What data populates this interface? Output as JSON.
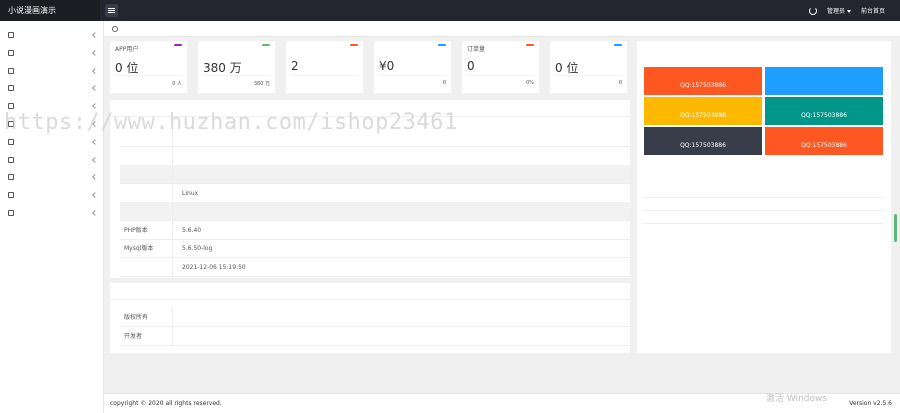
{
  "topbar": {
    "brand": "小说漫画演示",
    "user": "管理员",
    "home": "前台首页"
  },
  "sidebar": {
    "items": [
      {
        "label": "",
        "icon": "gear-icon"
      },
      {
        "label": "",
        "icon": "book-icon"
      },
      {
        "label": "",
        "icon": "file-icon"
      },
      {
        "label": "",
        "icon": "box-icon"
      },
      {
        "label": "",
        "icon": "audio-icon"
      },
      {
        "label": "",
        "icon": "user-icon"
      },
      {
        "label": "",
        "icon": "gift-icon"
      },
      {
        "label": "",
        "icon": "money-icon"
      },
      {
        "label": "",
        "icon": "ad-icon"
      },
      {
        "label": "",
        "icon": "app-icon"
      },
      {
        "label": "",
        "icon": "admin-icon"
      }
    ]
  },
  "breadcrumb": {
    "text": ""
  },
  "stats": [
    {
      "title": "APP用户",
      "tag": "",
      "tag_color": "#9c27b0",
      "value": "0 位",
      "foot_l": "",
      "foot_r": "0 人"
    },
    {
      "title": "",
      "tag": "",
      "tag_color": "#5fb878",
      "value": "380 万",
      "foot_l": "",
      "foot_r": "380 万"
    },
    {
      "title": "",
      "tag": "",
      "tag_color": "#ff5722",
      "value": "2",
      "foot_l": "",
      "foot_r": ""
    },
    {
      "title": "",
      "tag": "",
      "tag_color": "#1e9fff",
      "value": "¥0",
      "foot_l": "",
      "foot_r": "0"
    },
    {
      "title": "订单量",
      "tag": "",
      "tag_color": "#ff5722",
      "value": "0",
      "foot_l": "",
      "foot_r": "0%"
    },
    {
      "title": "",
      "tag": "",
      "tag_color": "#1e9fff",
      "value": "0 位",
      "foot_l": "",
      "foot_r": "0"
    }
  ],
  "system": {
    "title": "",
    "rows": [
      {
        "k": "",
        "v": ""
      },
      {
        "k": "",
        "v": ""
      },
      {
        "k": "",
        "v": ""
      },
      {
        "k": "",
        "v": "Linux"
      },
      {
        "k": "",
        "v": ""
      },
      {
        "k": "PHP版本",
        "v": "5.6.40"
      },
      {
        "k": "Mysql版本",
        "v": "5.6.50-log"
      },
      {
        "k": "",
        "v": "2021-12-06 15:19:50"
      }
    ]
  },
  "team": {
    "title": "",
    "rows": [
      {
        "k": "版权所有",
        "v": ""
      },
      {
        "k": "开发者",
        "v": ""
      }
    ]
  },
  "ads": {
    "title": "",
    "items": [
      {
        "l1": "",
        "l2": "QQ:157503886",
        "color": "#ff5722"
      },
      {
        "l1": "",
        "l2": "",
        "color": "#1e9fff"
      },
      {
        "l1": "",
        "l2": "QQ:157503886",
        "color": "#ffb800"
      },
      {
        "l1": "",
        "l2": "QQ:157503886",
        "color": "#009688"
      },
      {
        "l1": "",
        "l2": "QQ:157503886",
        "color": "#393d49"
      },
      {
        "l1": "",
        "l2": "QQ:157503886",
        "color": "#ff5722"
      }
    ]
  },
  "notices": {
    "title": "",
    "items": [
      {
        "text": "",
        "date": ""
      },
      {
        "text": "",
        "date": ""
      },
      {
        "text": "",
        "date": ""
      }
    ]
  },
  "footer": {
    "copy_prefix": "copyright © 2020",
    "copy_link": "",
    "copy_suffix": "all rights reserved.",
    "version": "Version v2.5.6"
  },
  "watermark": {
    "activate": "激活 Windows",
    "activate_sub": "",
    "overlay": "https://www.huzhan.com/ishop23461"
  }
}
